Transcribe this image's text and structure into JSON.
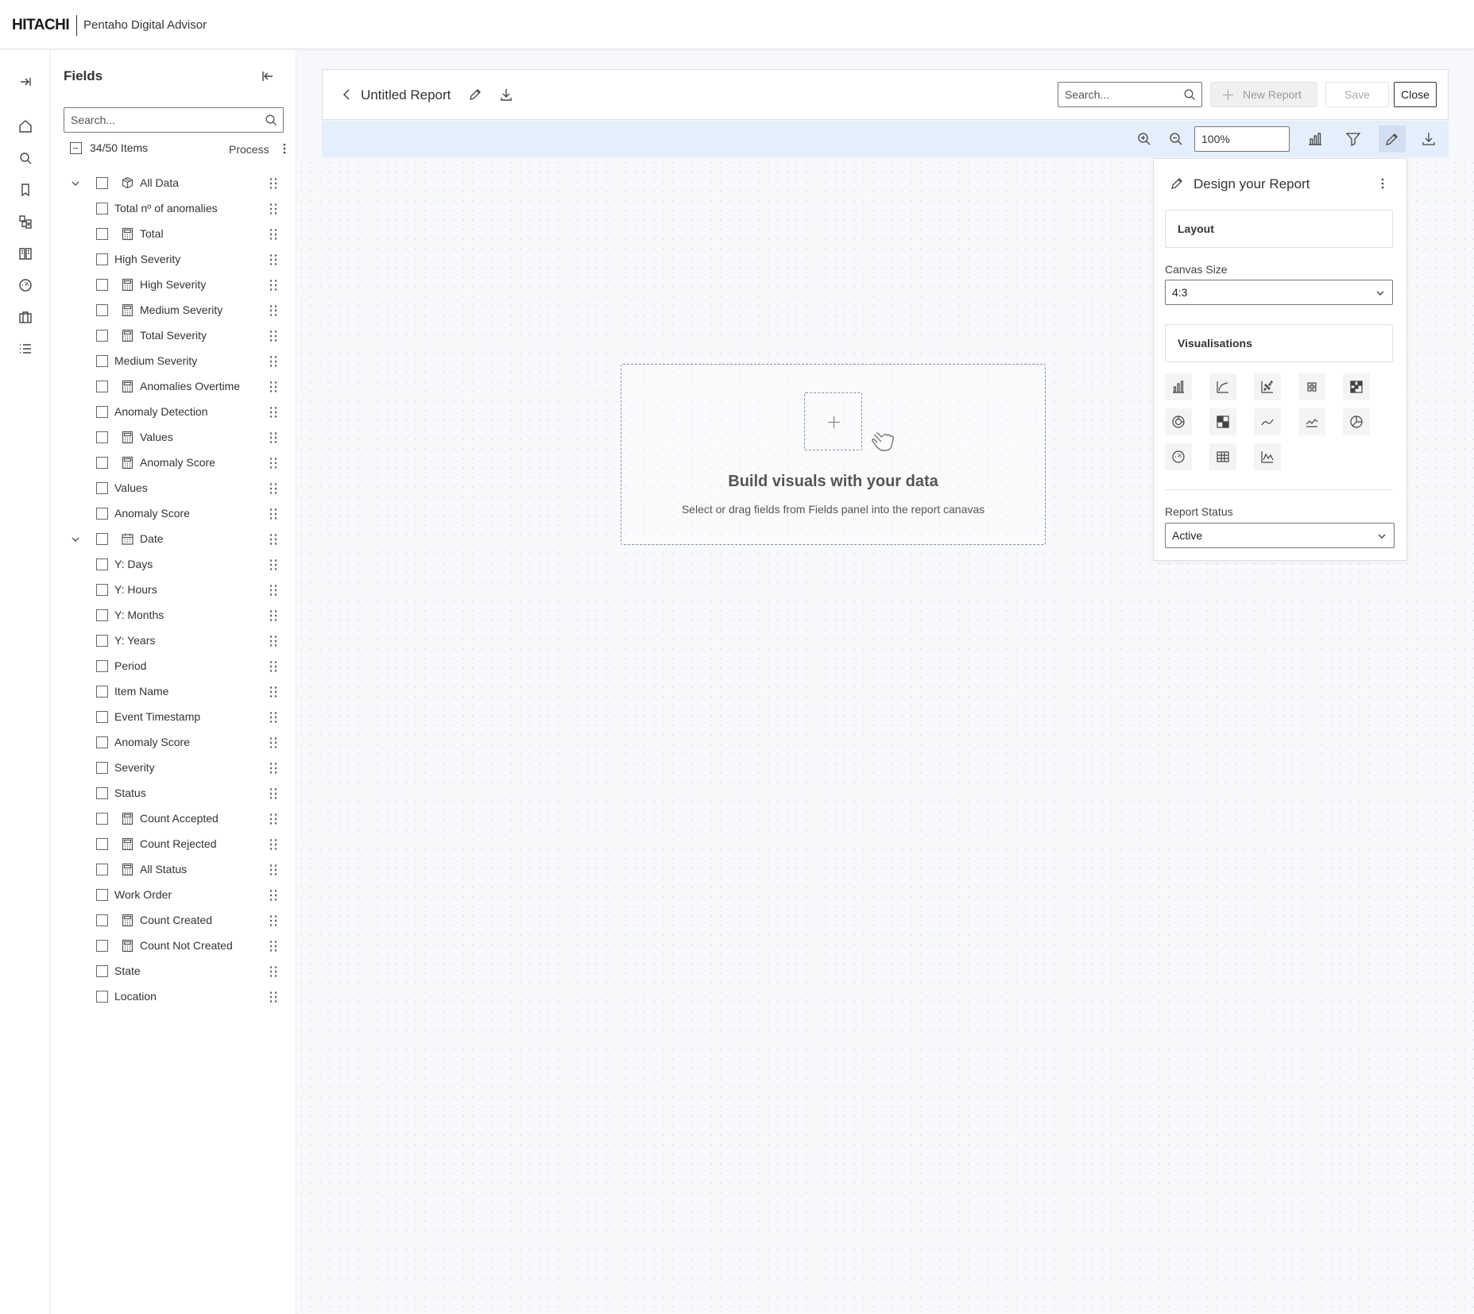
{
  "header": {
    "brand": "HITACHI",
    "product": "Pentaho Digital Advisor"
  },
  "rail": {
    "icons": [
      "expand-icon",
      "home-icon",
      "search-icon",
      "bookmark-icon",
      "hierarchy-icon",
      "book-icon",
      "gauge-icon",
      "briefcase-icon",
      "list-icon"
    ]
  },
  "fields": {
    "title": "Fields",
    "search_placeholder": "Search...",
    "items_count": "34/50 Items",
    "process_label": "Process",
    "items": [
      {
        "label": "All Data",
        "icon": "cube-icon",
        "group": true
      },
      {
        "label": "Total nº of anomalies"
      },
      {
        "label": "Total",
        "icon": "calculator-icon"
      },
      {
        "label": "High Severity"
      },
      {
        "label": "High Severity",
        "icon": "calculator-icon"
      },
      {
        "label": "Medium Severity",
        "icon": "calculator-icon"
      },
      {
        "label": "Total Severity",
        "icon": "calculator-icon"
      },
      {
        "label": "Medium Severity"
      },
      {
        "label": "Anomalies Overtime",
        "icon": "calculator-icon"
      },
      {
        "label": "Anomaly Detection"
      },
      {
        "label": "Values",
        "icon": "calculator-icon"
      },
      {
        "label": "Anomaly Score",
        "icon": "calculator-icon"
      },
      {
        "label": "Values"
      },
      {
        "label": "Anomaly Score"
      },
      {
        "label": "Date",
        "icon": "calendar-icon",
        "group": true
      },
      {
        "label": "Y: Days"
      },
      {
        "label": "Y: Hours"
      },
      {
        "label": "Y: Months"
      },
      {
        "label": "Y: Years"
      },
      {
        "label": "Period"
      },
      {
        "label": "Item Name"
      },
      {
        "label": "Event Timestamp"
      },
      {
        "label": "Anomaly Score"
      },
      {
        "label": "Severity"
      },
      {
        "label": "Status"
      },
      {
        "label": "Count Accepted",
        "icon": "calculator-icon"
      },
      {
        "label": "Count Rejected",
        "icon": "calculator-icon"
      },
      {
        "label": "All Status",
        "icon": "calculator-icon"
      },
      {
        "label": "Work Order"
      },
      {
        "label": "Count Created",
        "icon": "calculator-icon"
      },
      {
        "label": "Count Not Created",
        "icon": "calculator-icon"
      },
      {
        "label": "State"
      },
      {
        "label": "Location"
      }
    ]
  },
  "report": {
    "title": "Untitled Report",
    "search_placeholder": "Search...",
    "new_report_label": "New Report",
    "save_label": "Save",
    "close_label": "Close"
  },
  "toolbar": {
    "zoom_value": "100%"
  },
  "canvas": {
    "empty_title": "Build visuals with your data",
    "empty_subtitle": "Select or drag fields from Fields panel into the report canavas"
  },
  "design_panel": {
    "title": "Design your Report",
    "layout_label": "Layout",
    "canvas_size_label": "Canvas Size",
    "canvas_size_value": "4:3",
    "visualisations_label": "Visualisations",
    "visualisations": [
      "bar-chart-icon",
      "area-chart-icon",
      "scatter-chart-icon",
      "grid-icon",
      "heatmap-icon",
      "donut-chart-icon",
      "treemap-icon",
      "line-chart-icon",
      "line-markers-chart-icon",
      "pie-chart-icon",
      "gauge-chart-icon",
      "table-icon",
      "multi-line-chart-icon"
    ],
    "report_status_label": "Report Status",
    "report_status_value": "Active"
  }
}
